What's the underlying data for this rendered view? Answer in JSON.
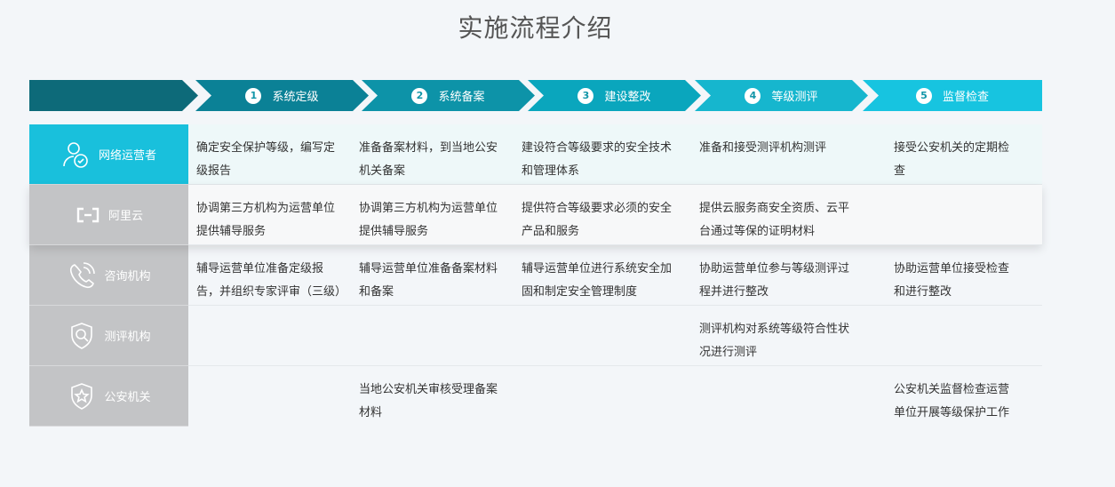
{
  "title": "实施流程介绍",
  "steps": [
    {
      "num": "1",
      "label": "系统定级",
      "color": "#0b8196"
    },
    {
      "num": "2",
      "label": "系统备案",
      "color": "#0d93a8"
    },
    {
      "num": "3",
      "label": "建设整改",
      "color": "#0aa6bd"
    },
    {
      "num": "4",
      "label": "等级测评",
      "color": "#16b6ce"
    },
    {
      "num": "5",
      "label": "监督检查",
      "color": "#17c4e0"
    }
  ],
  "rows": [
    {
      "role": "网络运营者",
      "icon": "user-shield-icon",
      "cells": [
        "确定安全保护等级，编写定级报告",
        "准备备案材料，到当地公安机关备案",
        "建设符合等级要求的安全技术和管理体系",
        "准备和接受测评机构测评",
        "接受公安机关的定期检查"
      ]
    },
    {
      "role": "阿里云",
      "icon": "aliyun-logo-icon",
      "cells": [
        "协调第三方机构为运营单位提供辅导服务",
        "协调第三方机构为运营单位提供辅导服务",
        "提供符合等级要求必须的安全产品和服务",
        "提供云服务商安全资质、云平台通过等保的证明材料",
        ""
      ]
    },
    {
      "role": "咨询机构",
      "icon": "consult-phone-icon",
      "cells": [
        "辅导运营单位准备定级报告，并组织专家评审（三级）",
        "辅导运营单位准备备案材料和备案",
        "辅导运营单位进行系统安全加固和制定安全管理制度",
        "协助运营单位参与等级测评过程并进行整改",
        "协助运营单位接受检查和进行整改"
      ]
    },
    {
      "role": "测评机构",
      "icon": "search-shield-icon",
      "cells": [
        "",
        "",
        "",
        "测评机构对系统等级符合性状况进行测评",
        ""
      ]
    },
    {
      "role": "公安机关",
      "icon": "star-shield-icon",
      "cells": [
        "",
        "当地公安机关审核受理备案材料",
        "",
        "",
        "公安机关监督检查运营单位开展等级保护工作"
      ]
    }
  ]
}
